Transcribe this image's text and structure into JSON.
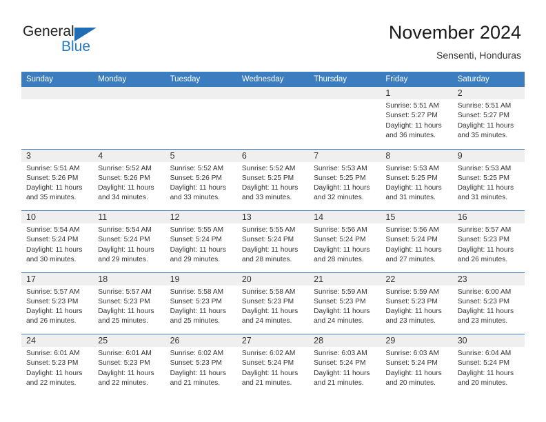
{
  "brand": {
    "name_part1": "General",
    "name_part2": "Blue",
    "triangle_color": "#1f6eb5",
    "blue_color": "#2279c4"
  },
  "header": {
    "title": "November 2024",
    "subtitle": "Sensenti, Honduras"
  },
  "theme": {
    "header_blue": "#3b7dbf",
    "day_band_gray": "#efefef",
    "text_color": "#333333"
  },
  "weekdays": [
    "Sunday",
    "Monday",
    "Tuesday",
    "Wednesday",
    "Thursday",
    "Friday",
    "Saturday"
  ],
  "labels": {
    "sunrise": "Sunrise:",
    "sunset": "Sunset:",
    "daylight": "Daylight:"
  },
  "weeks": [
    [
      {
        "day": "",
        "empty": true
      },
      {
        "day": "",
        "empty": true
      },
      {
        "day": "",
        "empty": true
      },
      {
        "day": "",
        "empty": true
      },
      {
        "day": "",
        "empty": true
      },
      {
        "day": "1",
        "sunrise": "Sunrise: 5:51 AM",
        "sunset": "Sunset: 5:27 PM",
        "daylight1": "Daylight: 11 hours",
        "daylight2": "and 36 minutes."
      },
      {
        "day": "2",
        "sunrise": "Sunrise: 5:51 AM",
        "sunset": "Sunset: 5:27 PM",
        "daylight1": "Daylight: 11 hours",
        "daylight2": "and 35 minutes."
      }
    ],
    [
      {
        "day": "3",
        "sunrise": "Sunrise: 5:51 AM",
        "sunset": "Sunset: 5:26 PM",
        "daylight1": "Daylight: 11 hours",
        "daylight2": "and 35 minutes."
      },
      {
        "day": "4",
        "sunrise": "Sunrise: 5:52 AM",
        "sunset": "Sunset: 5:26 PM",
        "daylight1": "Daylight: 11 hours",
        "daylight2": "and 34 minutes."
      },
      {
        "day": "5",
        "sunrise": "Sunrise: 5:52 AM",
        "sunset": "Sunset: 5:26 PM",
        "daylight1": "Daylight: 11 hours",
        "daylight2": "and 33 minutes."
      },
      {
        "day": "6",
        "sunrise": "Sunrise: 5:52 AM",
        "sunset": "Sunset: 5:25 PM",
        "daylight1": "Daylight: 11 hours",
        "daylight2": "and 33 minutes."
      },
      {
        "day": "7",
        "sunrise": "Sunrise: 5:53 AM",
        "sunset": "Sunset: 5:25 PM",
        "daylight1": "Daylight: 11 hours",
        "daylight2": "and 32 minutes."
      },
      {
        "day": "8",
        "sunrise": "Sunrise: 5:53 AM",
        "sunset": "Sunset: 5:25 PM",
        "daylight1": "Daylight: 11 hours",
        "daylight2": "and 31 minutes."
      },
      {
        "day": "9",
        "sunrise": "Sunrise: 5:53 AM",
        "sunset": "Sunset: 5:25 PM",
        "daylight1": "Daylight: 11 hours",
        "daylight2": "and 31 minutes."
      }
    ],
    [
      {
        "day": "10",
        "sunrise": "Sunrise: 5:54 AM",
        "sunset": "Sunset: 5:24 PM",
        "daylight1": "Daylight: 11 hours",
        "daylight2": "and 30 minutes."
      },
      {
        "day": "11",
        "sunrise": "Sunrise: 5:54 AM",
        "sunset": "Sunset: 5:24 PM",
        "daylight1": "Daylight: 11 hours",
        "daylight2": "and 29 minutes."
      },
      {
        "day": "12",
        "sunrise": "Sunrise: 5:55 AM",
        "sunset": "Sunset: 5:24 PM",
        "daylight1": "Daylight: 11 hours",
        "daylight2": "and 29 minutes."
      },
      {
        "day": "13",
        "sunrise": "Sunrise: 5:55 AM",
        "sunset": "Sunset: 5:24 PM",
        "daylight1": "Daylight: 11 hours",
        "daylight2": "and 28 minutes."
      },
      {
        "day": "14",
        "sunrise": "Sunrise: 5:56 AM",
        "sunset": "Sunset: 5:24 PM",
        "daylight1": "Daylight: 11 hours",
        "daylight2": "and 28 minutes."
      },
      {
        "day": "15",
        "sunrise": "Sunrise: 5:56 AM",
        "sunset": "Sunset: 5:24 PM",
        "daylight1": "Daylight: 11 hours",
        "daylight2": "and 27 minutes."
      },
      {
        "day": "16",
        "sunrise": "Sunrise: 5:57 AM",
        "sunset": "Sunset: 5:23 PM",
        "daylight1": "Daylight: 11 hours",
        "daylight2": "and 26 minutes."
      }
    ],
    [
      {
        "day": "17",
        "sunrise": "Sunrise: 5:57 AM",
        "sunset": "Sunset: 5:23 PM",
        "daylight1": "Daylight: 11 hours",
        "daylight2": "and 26 minutes."
      },
      {
        "day": "18",
        "sunrise": "Sunrise: 5:57 AM",
        "sunset": "Sunset: 5:23 PM",
        "daylight1": "Daylight: 11 hours",
        "daylight2": "and 25 minutes."
      },
      {
        "day": "19",
        "sunrise": "Sunrise: 5:58 AM",
        "sunset": "Sunset: 5:23 PM",
        "daylight1": "Daylight: 11 hours",
        "daylight2": "and 25 minutes."
      },
      {
        "day": "20",
        "sunrise": "Sunrise: 5:58 AM",
        "sunset": "Sunset: 5:23 PM",
        "daylight1": "Daylight: 11 hours",
        "daylight2": "and 24 minutes."
      },
      {
        "day": "21",
        "sunrise": "Sunrise: 5:59 AM",
        "sunset": "Sunset: 5:23 PM",
        "daylight1": "Daylight: 11 hours",
        "daylight2": "and 24 minutes."
      },
      {
        "day": "22",
        "sunrise": "Sunrise: 5:59 AM",
        "sunset": "Sunset: 5:23 PM",
        "daylight1": "Daylight: 11 hours",
        "daylight2": "and 23 minutes."
      },
      {
        "day": "23",
        "sunrise": "Sunrise: 6:00 AM",
        "sunset": "Sunset: 5:23 PM",
        "daylight1": "Daylight: 11 hours",
        "daylight2": "and 23 minutes."
      }
    ],
    [
      {
        "day": "24",
        "sunrise": "Sunrise: 6:01 AM",
        "sunset": "Sunset: 5:23 PM",
        "daylight1": "Daylight: 11 hours",
        "daylight2": "and 22 minutes."
      },
      {
        "day": "25",
        "sunrise": "Sunrise: 6:01 AM",
        "sunset": "Sunset: 5:23 PM",
        "daylight1": "Daylight: 11 hours",
        "daylight2": "and 22 minutes."
      },
      {
        "day": "26",
        "sunrise": "Sunrise: 6:02 AM",
        "sunset": "Sunset: 5:23 PM",
        "daylight1": "Daylight: 11 hours",
        "daylight2": "and 21 minutes."
      },
      {
        "day": "27",
        "sunrise": "Sunrise: 6:02 AM",
        "sunset": "Sunset: 5:24 PM",
        "daylight1": "Daylight: 11 hours",
        "daylight2": "and 21 minutes."
      },
      {
        "day": "28",
        "sunrise": "Sunrise: 6:03 AM",
        "sunset": "Sunset: 5:24 PM",
        "daylight1": "Daylight: 11 hours",
        "daylight2": "and 21 minutes."
      },
      {
        "day": "29",
        "sunrise": "Sunrise: 6:03 AM",
        "sunset": "Sunset: 5:24 PM",
        "daylight1": "Daylight: 11 hours",
        "daylight2": "and 20 minutes."
      },
      {
        "day": "30",
        "sunrise": "Sunrise: 6:04 AM",
        "sunset": "Sunset: 5:24 PM",
        "daylight1": "Daylight: 11 hours",
        "daylight2": "and 20 minutes."
      }
    ]
  ]
}
